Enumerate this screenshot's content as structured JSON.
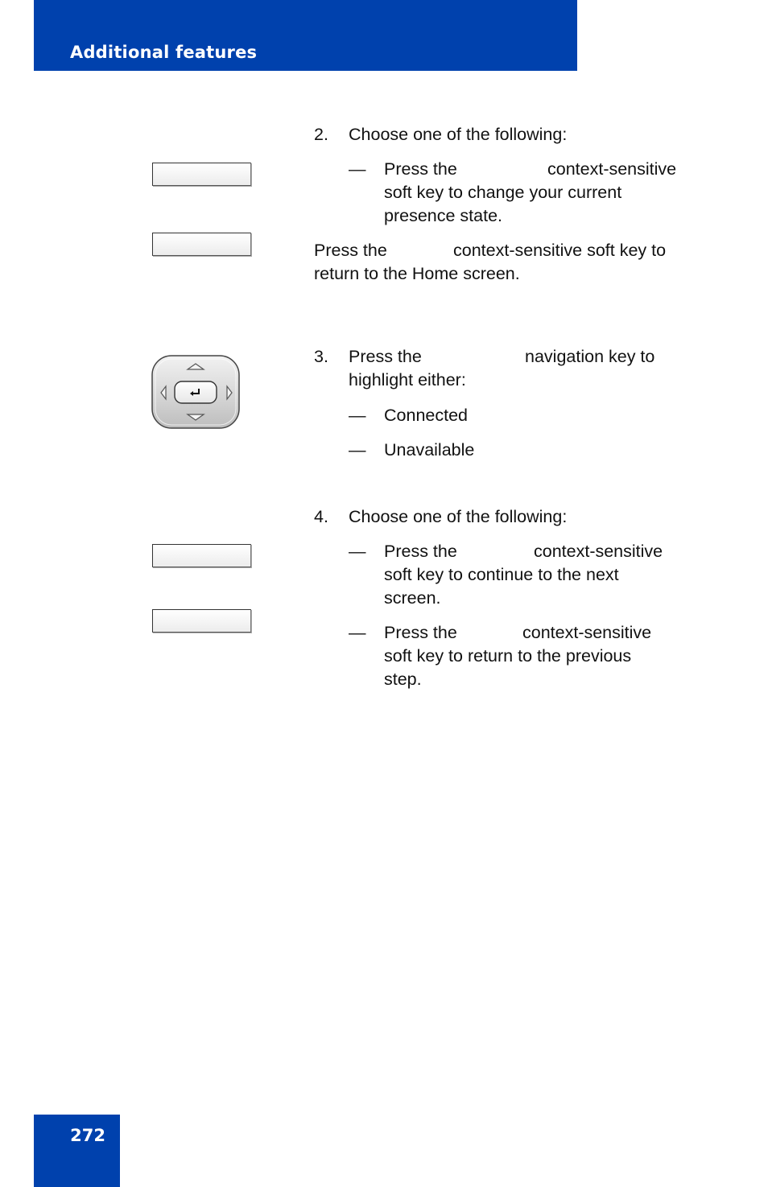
{
  "header": {
    "title": "Additional features"
  },
  "footer": {
    "page_number": "272"
  },
  "colors": {
    "brand_blue": "#0041ad"
  },
  "steps": {
    "step2": {
      "number": "2.",
      "intro": "Choose one of the following:",
      "option1": {
        "dash": "—",
        "pre": "Press the",
        "post": "context-sensitive",
        "line2": "soft key to change your current",
        "line3": "presence state."
      },
      "note": {
        "pre": "Press the",
        "post": "context-sensitive soft key to",
        "line2": "return to the Home screen."
      }
    },
    "step3": {
      "number": "3.",
      "pre": "Press the",
      "post": "navigation key to",
      "line2": "highlight either:",
      "options": [
        {
          "dash": "—",
          "label": "Connected"
        },
        {
          "dash": "—",
          "label": "Unavailable"
        }
      ]
    },
    "step4": {
      "number": "4.",
      "intro": "Choose one of the following:",
      "option1": {
        "dash": "—",
        "pre": "Press the",
        "post": "context-sensitive",
        "line2": "soft key to continue to the next",
        "line3": "screen."
      },
      "option2": {
        "dash": "—",
        "pre": "Press the",
        "post": "context-sensitive",
        "line2": "soft key to return to the previous",
        "line3": "step."
      }
    }
  },
  "icons": {
    "softkey": "blank-soft-key-icon",
    "navigation": "navigation-cluster-icon"
  }
}
